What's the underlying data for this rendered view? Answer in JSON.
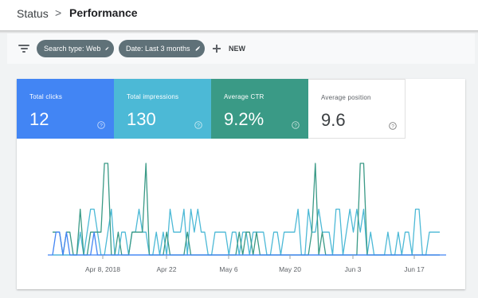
{
  "breadcrumb": {
    "parent": "Status",
    "separator": ">",
    "current": "Performance"
  },
  "filters": {
    "chips": [
      {
        "label": "Search type: Web"
      },
      {
        "label": "Date: Last 3 months"
      }
    ],
    "new_label": "NEW"
  },
  "metrics": [
    {
      "label": "Total clicks",
      "value": "12",
      "color": "#4285f4"
    },
    {
      "label": "Total impressions",
      "value": "130",
      "color": "#4cb9d6"
    },
    {
      "label": "Average CTR",
      "value": "9.2%",
      "color": "#3a9a86"
    },
    {
      "label": "Average position",
      "value": "9.6",
      "color": "#ffffff"
    }
  ],
  "chart_data": {
    "type": "line",
    "x_ticks": [
      "Apr 8, 2018",
      "Apr 22",
      "May 6",
      "May 20",
      "Jun 3",
      "Jun 17"
    ],
    "y_range": [
      0,
      4
    ],
    "grid": false,
    "series": [
      {
        "color": "#4cb9d6",
        "values": [
          0,
          0,
          0,
          0,
          0,
          0,
          0,
          0,
          1,
          0,
          1,
          2,
          2,
          1,
          0,
          0,
          1,
          2,
          0,
          0,
          1,
          1,
          0,
          1,
          1,
          2,
          1,
          1,
          0,
          0,
          1,
          0,
          1,
          0,
          2,
          1,
          1,
          1,
          2,
          0,
          2,
          1,
          2,
          1,
          1,
          0,
          0,
          1,
          1,
          1,
          1,
          0,
          1,
          1,
          0,
          1,
          1,
          0,
          1,
          1,
          1,
          1,
          0,
          0,
          1,
          1,
          0,
          1,
          1,
          1,
          1,
          2,
          0,
          0,
          2,
          1,
          1,
          2,
          1,
          1,
          1,
          0,
          2,
          2,
          0,
          1,
          2,
          1,
          2,
          1,
          2,
          0,
          1,
          0,
          0,
          0,
          0,
          1,
          0,
          0,
          1,
          0,
          1,
          1,
          0,
          2,
          2,
          0,
          0,
          1,
          1,
          1,
          1
        ]
      },
      {
        "color": "#3a9a86",
        "values": [
          1,
          1,
          1,
          0,
          1,
          1,
          0,
          0,
          2,
          0,
          0,
          1,
          1,
          1,
          1,
          4,
          4,
          0,
          0,
          1,
          0,
          0,
          0,
          1,
          1,
          1,
          1,
          4,
          0,
          0,
          0,
          0,
          0,
          1,
          0,
          0,
          0,
          0,
          0,
          1,
          0,
          0,
          0,
          0,
          0,
          0,
          0,
          0,
          0,
          0,
          0,
          0,
          0,
          0,
          1,
          0,
          1,
          1,
          0,
          1,
          0,
          0,
          0,
          0,
          0,
          0,
          0,
          0,
          0,
          0,
          0,
          0,
          0,
          0,
          0,
          1,
          4,
          0,
          1,
          0,
          0,
          0,
          0,
          0,
          0,
          0,
          0,
          0,
          0,
          4,
          4,
          0,
          0,
          0,
          0,
          0,
          0,
          0,
          0,
          0,
          0,
          0,
          0,
          0,
          0,
          0,
          0,
          0,
          0,
          0,
          0,
          0,
          0
        ]
      },
      {
        "color": "#4285f4",
        "values": [
          0,
          1,
          1,
          0,
          1,
          0,
          0,
          0,
          0,
          0,
          0,
          0,
          1,
          0,
          0,
          0,
          0,
          0,
          0,
          0,
          0,
          0,
          0,
          0,
          0,
          0,
          0,
          0,
          0,
          0,
          0,
          0,
          0,
          0,
          0,
          0,
          0,
          0,
          0,
          0,
          0,
          0,
          0,
          0,
          0,
          0,
          0,
          0,
          0,
          0,
          0,
          0,
          0,
          0,
          0,
          0,
          0,
          0,
          0,
          0,
          0,
          0,
          0,
          0,
          0,
          0,
          0,
          0,
          0,
          0,
          0,
          0,
          0,
          0,
          0,
          0,
          0,
          0,
          0,
          0,
          0,
          0,
          0,
          0,
          0,
          0,
          0,
          0,
          0,
          0,
          0,
          0,
          0,
          0,
          0,
          0,
          0,
          0,
          0,
          0,
          0,
          0,
          0,
          0,
          0,
          0,
          0,
          0,
          0,
          0,
          0,
          0,
          0
        ]
      }
    ]
  }
}
